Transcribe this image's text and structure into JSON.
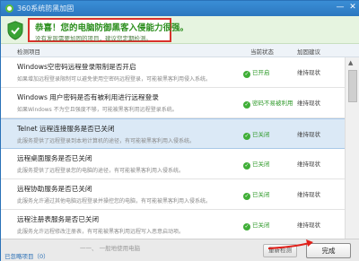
{
  "window": {
    "title": "360系统防黑加固",
    "minimize_label": "—",
    "close_label": "✕"
  },
  "banner": {
    "main_text": "恭喜！您的电脑防御黑客入侵能力很强。",
    "sub_text": "没有发现需要加固的项目，建议您定期检测。"
  },
  "columns": {
    "item": "检测项目",
    "status": "当前状态",
    "advice": "加固建议"
  },
  "rows": [
    {
      "title": "Windows空密码远程登录限制是否开启",
      "desc": "如果增加远程登录限制可以避免使用空密码远程登录，可能被黑客利用侵入系统。",
      "status": "已开启",
      "advice": "维持现状"
    },
    {
      "title": "Windows 用户密码是否有被利用进行远程登录",
      "desc": "如果Windows 不为空且强度不够，可能被黑客利用远程登录系统。",
      "status": "密码不易被利用",
      "advice": "维持现状"
    },
    {
      "title": "Telnet 远程连接服务是否已关闭",
      "desc": "此服务提供了远程登录到本地计算机的途径，有可能被黑客利用入侵系统。",
      "status": "已关闭",
      "advice": "维持现状"
    },
    {
      "title": "远程桌面服务是否已关闭",
      "desc": "此服务提供了远程登录您的电脑的途径，有可能被黑客利用入侵系统。",
      "status": "已关闭",
      "advice": "维持现状"
    },
    {
      "title": "远程协助服务是否已关闭",
      "desc": "此服务允许通过其他电脑远程登录并操控您的电脑，有可能被黑客利用入侵系统。",
      "status": "已关闭",
      "advice": "维持现状"
    },
    {
      "title": "远程注册表服务是否已关闭",
      "desc": "此服务允许远程修改注册表，有可能被黑客利用远程写入恶意启动项。",
      "status": "已关闭",
      "advice": "维持现状"
    }
  ],
  "footer": {
    "ignored_link": "已忽略项目（0）",
    "watermark": "一一、 一般地使用电脑",
    "rescan_label": "重新检测",
    "done_label": "完成"
  },
  "colors": {
    "accent_blue": "#2f7fc6",
    "success_green": "#2d8f1f",
    "alert_red": "#d9312b"
  },
  "icons": {
    "shield": "shield-check-icon",
    "status": "check-circle-icon",
    "arrow": "red-arrow-icon"
  }
}
